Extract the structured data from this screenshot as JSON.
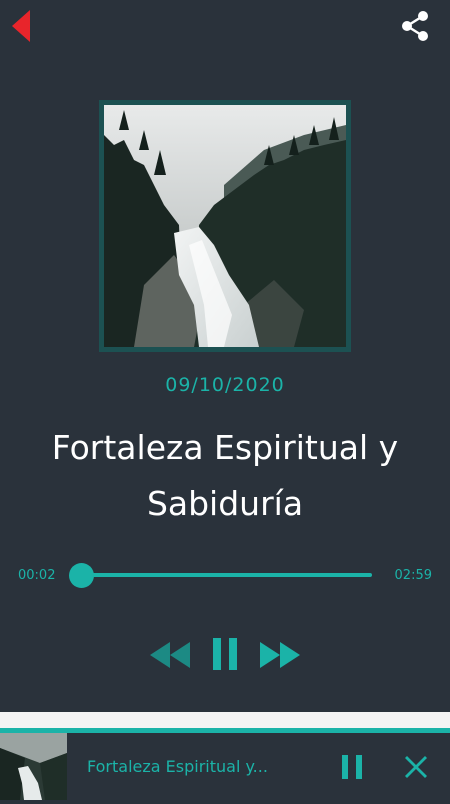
{
  "header": {
    "back_icon": "back-arrow-icon",
    "share_icon": "share-icon",
    "accent_back": "#e8252b"
  },
  "episode": {
    "date": "09/10/2020",
    "title": "Fortaleza Espiritual y Sabiduría",
    "cover_image": "waterfall-forest-photo"
  },
  "player": {
    "current_time": "00:02",
    "duration": "02:59",
    "progress_fraction": 0.011,
    "controls": [
      "rewind-icon",
      "pause-icon",
      "fast-forward-icon"
    ],
    "state": "playing"
  },
  "mini_player": {
    "title": "Fortaleza Espiritual y...",
    "pause_icon": "pause-icon",
    "close_icon": "close-icon"
  },
  "colors": {
    "background": "#2a323b",
    "accent": "#1bb3a8",
    "frame": "#1c5152"
  }
}
